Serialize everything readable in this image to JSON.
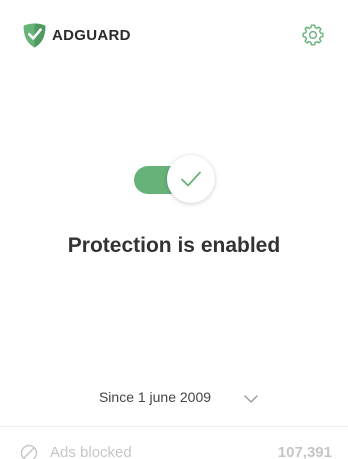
{
  "header": {
    "brand_name": "ADGUARD",
    "logo_icon": "shield-check-icon",
    "settings_icon": "gear-icon"
  },
  "protection": {
    "enabled": true,
    "status_text": "Protection is enabled",
    "toggle_check_icon": "checkmark-icon"
  },
  "period": {
    "label": "Since 1 june 2009",
    "chevron_icon": "chevron-down-icon"
  },
  "stats": {
    "items": [
      {
        "icon": "ad-block-icon",
        "label": "Ads blocked",
        "value": "107,391"
      }
    ]
  },
  "colors": {
    "accent": "#67b279",
    "text": "#333333",
    "background": "#ffffff",
    "divider": "#ececec"
  }
}
